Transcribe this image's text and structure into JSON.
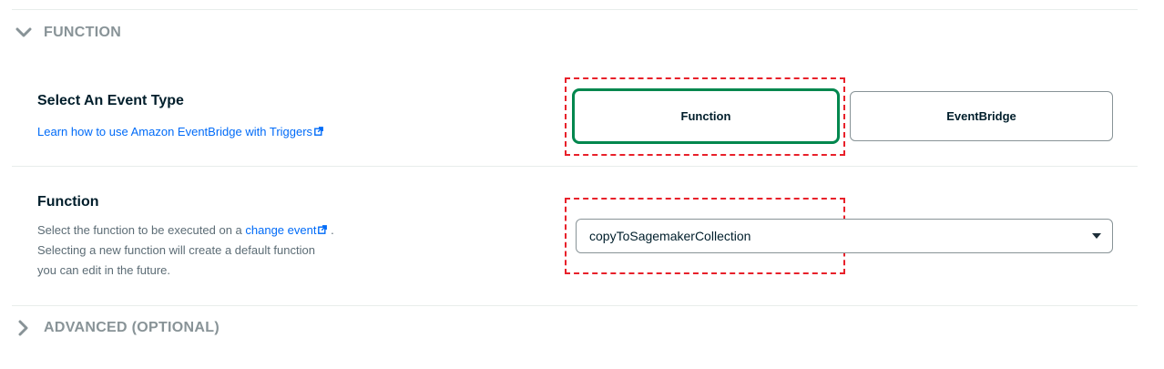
{
  "sections": {
    "function": {
      "label": "FUNCTION",
      "expanded": true
    },
    "advanced": {
      "label": "ADVANCED (OPTIONAL)",
      "expanded": false
    }
  },
  "event_type": {
    "title": "Select An Event Type",
    "help_link": "Learn how to use Amazon EventBridge with Triggers",
    "options": [
      {
        "label": "Function",
        "selected": true
      },
      {
        "label": "EventBridge",
        "selected": false
      }
    ]
  },
  "function_row": {
    "title": "Function",
    "desc_prefix": "Select the function to be executed on a ",
    "desc_link": "change event",
    "desc_suffix_1": " .",
    "desc_line_2": "Selecting a new function will create a default function",
    "desc_line_3": "you can edit in the future.",
    "selected_value": "copyToSagemakerCollection"
  },
  "colors": {
    "selected_border": "#00874e",
    "link": "#016bf8",
    "annotation": "#e8202a"
  }
}
